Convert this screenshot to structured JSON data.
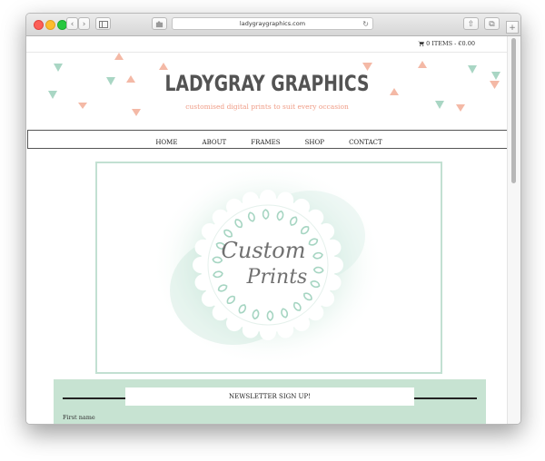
{
  "browser": {
    "url": "ladygraygraphics.com",
    "back_glyph": "‹",
    "forward_glyph": "›",
    "reload_glyph": "↻",
    "share_glyph": "⇧",
    "tabs_glyph": "⧉",
    "plus_glyph": "+"
  },
  "cart": {
    "text": "0 ITEMS - €0.00",
    "icon": "cart-icon"
  },
  "site": {
    "title": "LADYGRAY GRAPHICS",
    "tagline": "customised digital prints to suit every occasion",
    "title_color": "#535353",
    "tagline_color": "#ef9c86"
  },
  "nav": {
    "items": [
      {
        "label": "HOME"
      },
      {
        "label": "ABOUT"
      },
      {
        "label": "FRAMES"
      },
      {
        "label": "SHOP"
      },
      {
        "label": "CONTACT"
      }
    ]
  },
  "hero": {
    "line1": "Custom",
    "line2": "Prints",
    "accent": "#c2e0d2"
  },
  "newsletter": {
    "heading": "NEWSLETTER SIGN UP!",
    "first_name_label": "First name",
    "background": "#c7e3d2"
  },
  "decor": {
    "triangle_colors": [
      "#f4b9a6",
      "#a9d6c4"
    ]
  }
}
